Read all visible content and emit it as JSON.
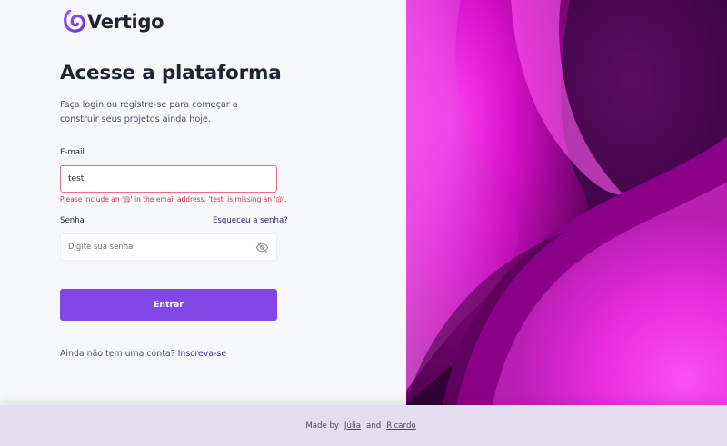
{
  "brand": {
    "name": "Vertigo",
    "accent_color": "#8247e5"
  },
  "login": {
    "title": "Acesse a plataforma",
    "subtitle": "Faça login ou registre-se para começar a construir seus projetos ainda hoje.",
    "email_label": "E-mail",
    "email_value": "test",
    "email_error": "Please include an '@' in the email address. 'test' is missing an '@'.",
    "password_label": "Senha",
    "forgot_password": "Esqueceu a senha?",
    "password_placeholder": "Digite sua senha",
    "submit_label": "Entrar",
    "signup_prompt": "Ainda não tem uma conta?",
    "signup_link": "Inscreva-se"
  },
  "icons": {
    "logo": "vertigo-logo-icon",
    "password_toggle": "eye-off-icon"
  },
  "footer": {
    "made_by": "Made by",
    "author_1": "Júlia",
    "and": "and",
    "author_2": "Ricardo"
  }
}
